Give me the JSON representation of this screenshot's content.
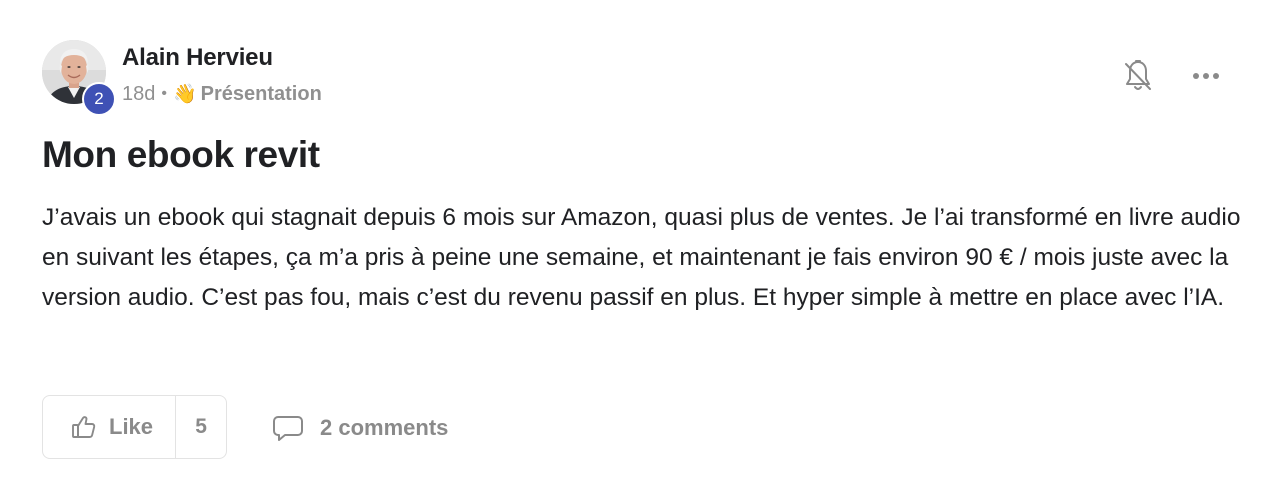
{
  "post": {
    "author": {
      "name": "Alain Hervieu",
      "level": "2"
    },
    "meta": {
      "time_ago": "18d",
      "separator": "•",
      "category_emoji": "👋",
      "category": "Présentation"
    },
    "title": "Mon ebook revit",
    "body": "J’avais un ebook qui stagnait depuis 6 mois sur Amazon, quasi plus de ventes. Je l’ai transformé en livre audio en suivant les étapes, ça m’a pris à peine une semaine, et maintenant je fais environ 90 € / mois juste avec la version audio. C’est pas fou, mais c’est du revenu passif en plus. Et hyper simple à mettre en place avec l’IA.",
    "actions": {
      "like_label": "Like",
      "like_count": "5",
      "comments_label": "2 comments"
    },
    "icons": {
      "bell": "bell-off-icon",
      "more": "more-horizontal-icon",
      "like": "thumbs-up-icon",
      "comment": "comment-icon"
    },
    "colors": {
      "level_badge": "#3f51b5",
      "muted_text": "#8a8a8a",
      "primary_text": "#202124"
    }
  }
}
